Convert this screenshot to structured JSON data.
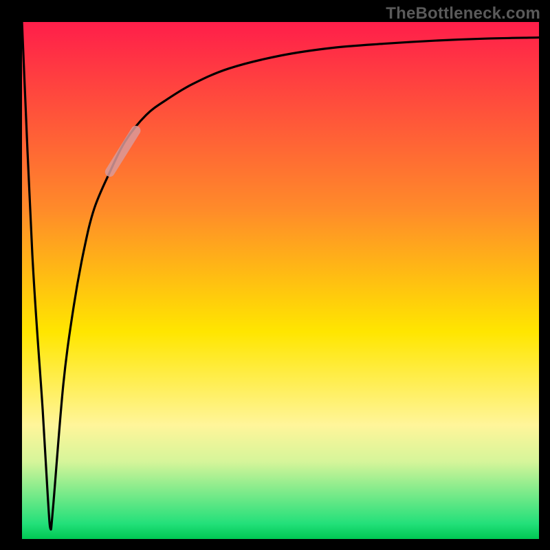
{
  "watermark": "TheBottleneck.com",
  "chart_data": {
    "type": "line",
    "title": "",
    "xlabel": "",
    "ylabel": "",
    "xlim": [
      0,
      100
    ],
    "ylim": [
      0,
      100
    ],
    "grid": false,
    "legend": false,
    "series": [
      {
        "name": "curve",
        "x": [
          0,
          2,
          4,
          5,
          5.5,
          6,
          8,
          10,
          12,
          14,
          17,
          20,
          24,
          28,
          33,
          40,
          50,
          60,
          70,
          80,
          90,
          100
        ],
        "values": [
          100,
          55,
          25,
          8,
          2,
          6,
          30,
          45,
          56,
          64,
          71,
          77,
          82,
          85,
          88,
          91,
          93.5,
          95,
          95.8,
          96.4,
          96.8,
          97
        ]
      }
    ],
    "annotations": [
      {
        "name": "highlight-segment",
        "color": "#d99a9a",
        "x_range": [
          17,
          22
        ],
        "y_range": [
          71,
          79
        ]
      }
    ],
    "gradient_stops": [
      {
        "offset": 0,
        "color": "#ff1e4a"
      },
      {
        "offset": 36,
        "color": "#ff8a2a"
      },
      {
        "offset": 60,
        "color": "#ffe600"
      },
      {
        "offset": 78,
        "color": "#fff59a"
      },
      {
        "offset": 85,
        "color": "#d6f59a"
      },
      {
        "offset": 97,
        "color": "#23e07a"
      },
      {
        "offset": 100,
        "color": "#00c853"
      }
    ]
  }
}
